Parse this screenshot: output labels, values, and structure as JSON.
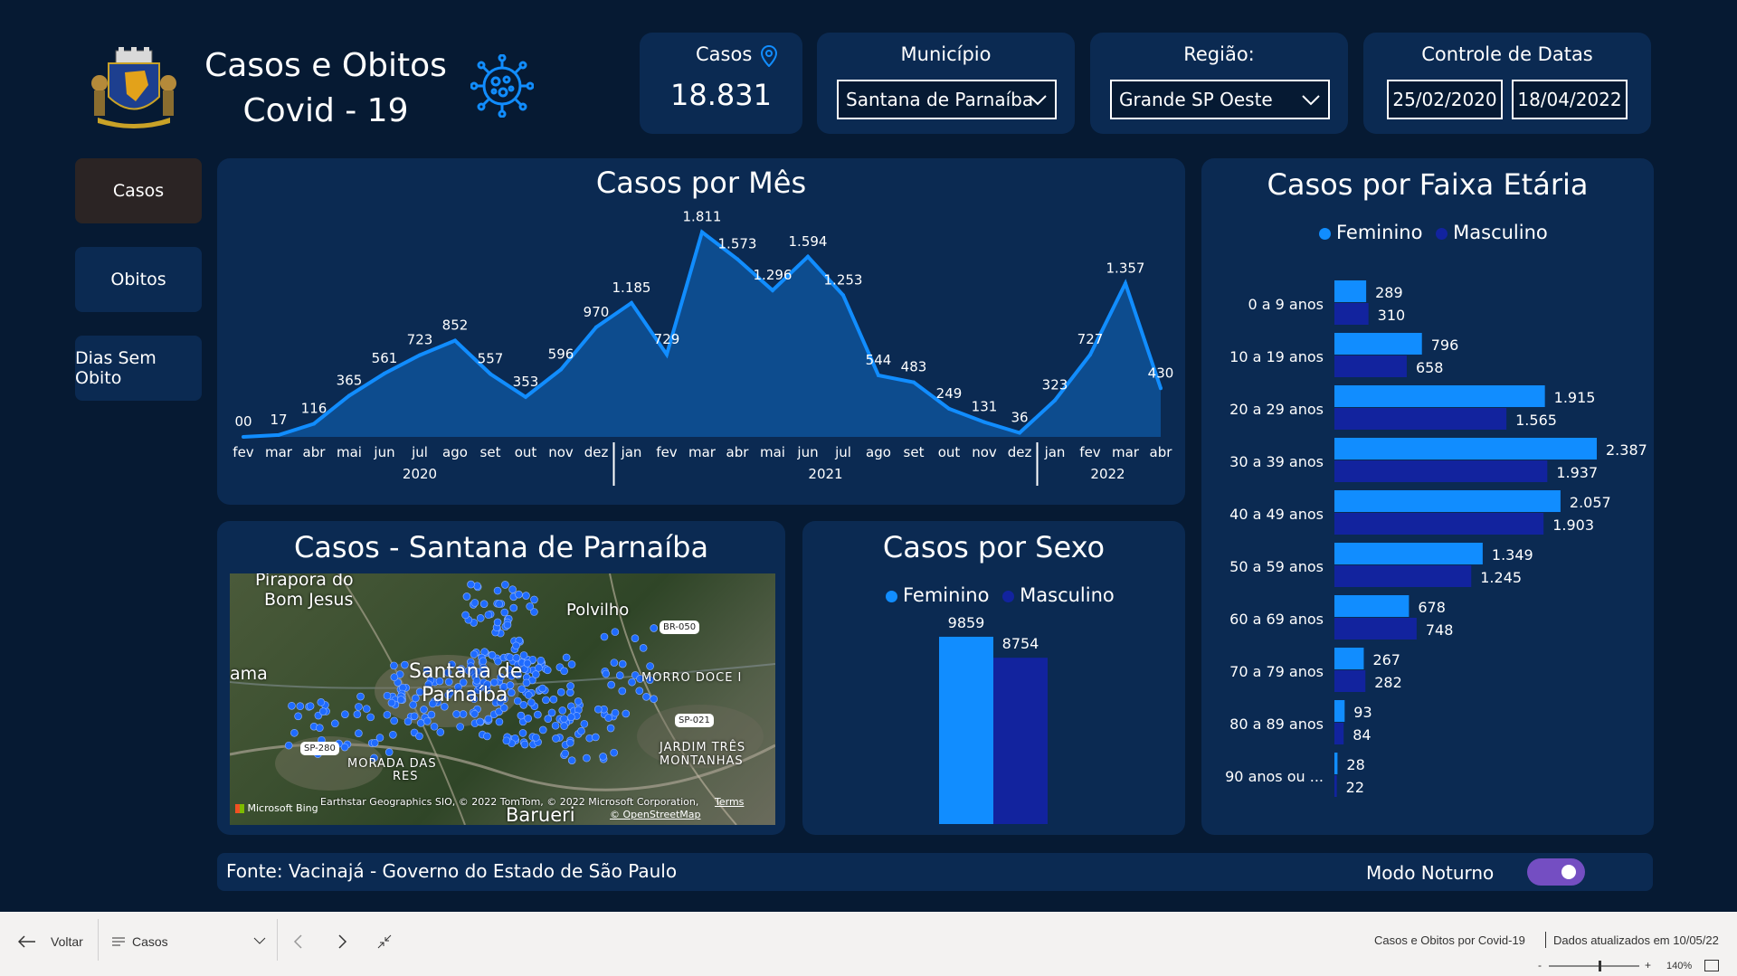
{
  "header": {
    "title_line1": "Casos e Obitos",
    "title_line2": "Covid - 19",
    "cases_label": "Casos",
    "cases_value": "18.831",
    "municipio_label": "Município",
    "municipio_value": "Santana de Parnaíba",
    "regiao_label": "Região:",
    "regiao_value": "Grande SP Oeste",
    "datas_label": "Controle de Datas",
    "date_start": "25/02/2020",
    "date_end": "18/04/2022"
  },
  "nav": {
    "casos": "Casos",
    "obitos": "Obitos",
    "dias": "Dias Sem Obito"
  },
  "monthly": {
    "title": "Casos por Mês",
    "year_labels": [
      "2020",
      "2021",
      "2022"
    ],
    "chart_data": {
      "type": "area",
      "x": [
        "fev",
        "mar",
        "abr",
        "mai",
        "jun",
        "jul",
        "ago",
        "set",
        "out",
        "nov",
        "dez",
        "jan",
        "fev",
        "mar",
        "abr",
        "mai",
        "jun",
        "jul",
        "ago",
        "set",
        "out",
        "nov",
        "dez",
        "jan",
        "fev",
        "mar",
        "abr"
      ],
      "values": [
        0,
        17,
        116,
        365,
        561,
        723,
        852,
        557,
        353,
        596,
        970,
        1185,
        729,
        1811,
        1573,
        1296,
        1594,
        1253,
        544,
        483,
        249,
        131,
        36,
        323,
        727,
        1357,
        430
      ],
      "labels": [
        "00",
        "17",
        "116",
        "365",
        "561",
        "723",
        "852",
        "557",
        "353",
        "596",
        "970",
        "1.185",
        "729",
        "1.811",
        "1.573",
        "1.296",
        "1.594",
        "1.253",
        "544",
        "483",
        "249",
        "131",
        "36",
        "323",
        "727",
        "1.357",
        "430"
      ],
      "color": "#118dff"
    }
  },
  "age": {
    "title": "Casos por Faixa Etária",
    "legend": [
      "Feminino",
      "Masculino"
    ],
    "chart_data": {
      "type": "bar",
      "categories": [
        "0 a 9 anos",
        "10 a 19 anos",
        "20 a 29 anos",
        "30 a 39 anos",
        "40 a 49 anos",
        "50 a 59 anos",
        "60 a 69 anos",
        "70 a 79 anos",
        "80 a 89 anos",
        "90 anos ou ..."
      ],
      "series": [
        {
          "name": "Feminino",
          "values": [
            289,
            796,
            1915,
            2387,
            2057,
            1349,
            678,
            267,
            93,
            28
          ],
          "labels": [
            "289",
            "796",
            "1.915",
            "2.387",
            "2.057",
            "1.349",
            "678",
            "267",
            "93",
            "28"
          ],
          "color": "#118dff"
        },
        {
          "name": "Masculino",
          "values": [
            310,
            658,
            1565,
            1937,
            1903,
            1245,
            748,
            282,
            84,
            22
          ],
          "labels": [
            "310",
            "658",
            "1.565",
            "1.937",
            "1.903",
            "1.245",
            "748",
            "282",
            "84",
            "22"
          ],
          "color": "#12239e"
        }
      ]
    }
  },
  "map": {
    "title": "Casos - Santana de Parnaíba",
    "places": [
      "Pirapora do",
      "Bom Jesus",
      "Polvilho",
      "Santana de",
      "Parnaíba",
      "MORRO DOCE I",
      "JARDIM TRÊS",
      "MONTANHAS",
      "MORADA DAS",
      "RES",
      "Barueri",
      "ama"
    ],
    "shields": [
      "BR-050",
      "SP-021",
      "SP-280"
    ],
    "attribution": "Earthstar Geographics SIO, © 2022 TomTom, © 2022 Microsoft Corporation,",
    "terms": "Terms",
    "osm": "© OpenStreetMap",
    "bing": "Microsoft Bing"
  },
  "sex": {
    "title": "Casos por Sexo",
    "legend": [
      "Feminino",
      "Masculino"
    ],
    "chart_data": {
      "type": "bar",
      "categories": [
        "Feminino",
        "Masculino"
      ],
      "values": [
        9859,
        8754
      ],
      "labels": [
        "9859",
        "8754"
      ],
      "colors": [
        "#118dff",
        "#12239e"
      ]
    }
  },
  "footer": {
    "source": "Fonte: Vacinajá - Governo do Estado de São Paulo",
    "night_mode": "Modo Noturno",
    "night_mode_on": true
  },
  "taskbar": {
    "back": "Voltar",
    "page": "Casos",
    "report_name": "Casos e Obitos por Covid-19",
    "updated": "Dados atualizados em 10/05/22",
    "zoom": "140%",
    "zoom_fraction": 0.55
  }
}
